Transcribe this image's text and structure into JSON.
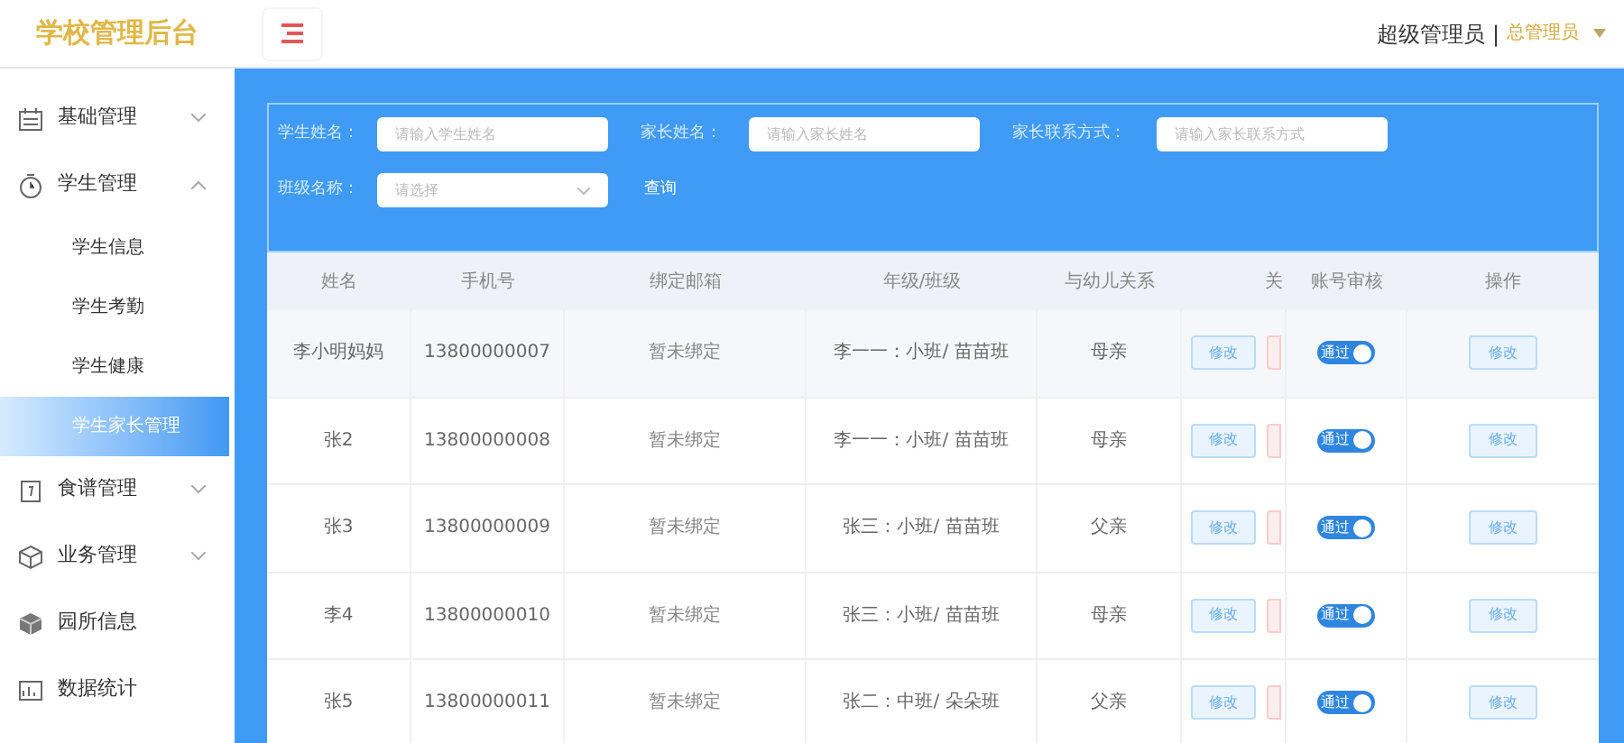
{
  "header": {
    "logo": "学校管理后台",
    "user_role": "超级管理员",
    "separator": "|",
    "user_name": "总管理员"
  },
  "sidebar": {
    "items": [
      {
        "label": "基础管理",
        "expanded": false
      },
      {
        "label": "学生管理",
        "expanded": true,
        "children": [
          {
            "label": "学生信息",
            "selected": false
          },
          {
            "label": "学生考勤",
            "selected": false
          },
          {
            "label": "学生健康",
            "selected": false
          },
          {
            "label": "学生家长管理",
            "selected": true
          }
        ]
      },
      {
        "label": "食谱管理",
        "expanded": false
      },
      {
        "label": "业务管理",
        "expanded": false
      },
      {
        "label": "园所信息"
      },
      {
        "label": "数据统计"
      }
    ]
  },
  "filters": {
    "fields": [
      {
        "label": "学生姓名：",
        "placeholder": "请输入学生姓名",
        "kind": "text"
      },
      {
        "label": "家长姓名：",
        "placeholder": "请输入家长姓名",
        "kind": "text"
      },
      {
        "label": "家长联系方式：",
        "placeholder": "请输入家长联系方式",
        "kind": "text"
      },
      {
        "label": "班级名称：",
        "placeholder": "请选择",
        "kind": "select"
      }
    ],
    "search_button": "查询"
  },
  "table": {
    "columns": [
      "姓名",
      "手机号",
      "绑定邮箱",
      "年级/班级",
      "与幼儿关系",
      "关",
      "账号审核",
      "操作"
    ],
    "rows": [
      {
        "name": "李小明妈妈",
        "phone": "13800000007",
        "email": "暂未绑定",
        "class": "李一一：小班/ 苗苗班",
        "relation": "母亲",
        "edit": "修改",
        "status_label": "通过",
        "status_on": true,
        "action": "修改"
      },
      {
        "name": "张2",
        "phone": "13800000008",
        "email": "暂未绑定",
        "class": "李一一：小班/ 苗苗班",
        "relation": "母亲",
        "edit": "修改",
        "status_label": "通过",
        "status_on": true,
        "action": "修改"
      },
      {
        "name": "张3",
        "phone": "13800000009",
        "email": "暂未绑定",
        "class": "张三：小班/ 苗苗班",
        "relation": "父亲",
        "edit": "修改",
        "status_label": "通过",
        "status_on": true,
        "action": "修改"
      },
      {
        "name": "李4",
        "phone": "13800000010",
        "email": "暂未绑定",
        "class": "张三：小班/ 苗苗班",
        "relation": "母亲",
        "edit": "修改",
        "status_label": "通过",
        "status_on": true,
        "action": "修改"
      },
      {
        "name": "张5",
        "phone": "13800000011",
        "email": "暂未绑定",
        "class": "张二：中班/ 朵朵班",
        "relation": "父亲",
        "edit": "修改",
        "status_label": "通过",
        "status_on": true,
        "action": "修改"
      }
    ]
  }
}
